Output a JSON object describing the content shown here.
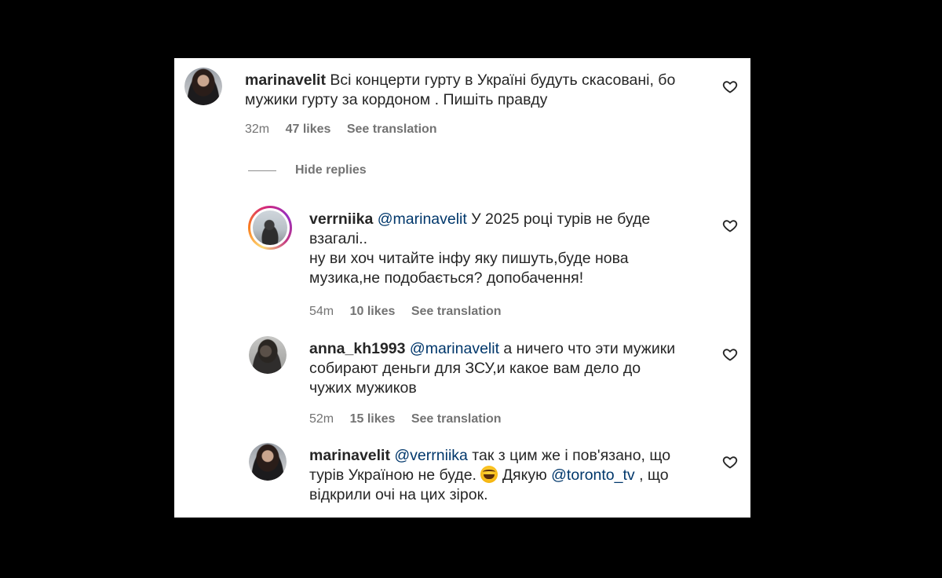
{
  "comments": [
    {
      "username": "marinavelit",
      "text_line1": "Всі концерти гурту в Україні будуть скасовані, бо",
      "text_line2": "мужики гурту за кордоном . Пишіть правду",
      "time": "32m",
      "likes": "47 likes",
      "see_translation": "See translation",
      "avatar_icon": "profile-photo"
    }
  ],
  "hide_replies_label": "Hide replies",
  "replies": [
    {
      "username": "verrniika",
      "mention": "@marinavelit",
      "text_line1": "У 2025 році турів не буде",
      "text_line2": "взагалі..",
      "text_line3": "ну ви хоч читайте інфу яку пишуть,буде нова",
      "text_line4": "музика,не подобається? допобачення!",
      "time": "54m",
      "likes": "10 likes",
      "see_translation": "See translation"
    },
    {
      "username": "anna_kh1993",
      "mention": "@marinavelit",
      "text_line1": "а ничего что эти мужики",
      "text_line2": "собирают деньги для ЗСУ,и какое вам дело до",
      "text_line3": "чужих мужиков",
      "time": "52m",
      "likes": "15 likes",
      "see_translation": "See translation"
    },
    {
      "username": "marinavelit",
      "mention": "@verrniika",
      "text_line1": "так з цим же і пов'язано, що",
      "text_line2a": "турів Україною не буде.",
      "text_line2b": "Дякую",
      "mention2": "@toronto_tv",
      "text_line2c": ", що",
      "text_line3": "відкрили очі на цих зірок.",
      "emoji_icon": "laughing-crying-emoji"
    }
  ],
  "colors": {
    "text": "#262626",
    "meta": "#737373",
    "mention": "#00376b",
    "background": "#ffffff",
    "outer": "#000000"
  }
}
